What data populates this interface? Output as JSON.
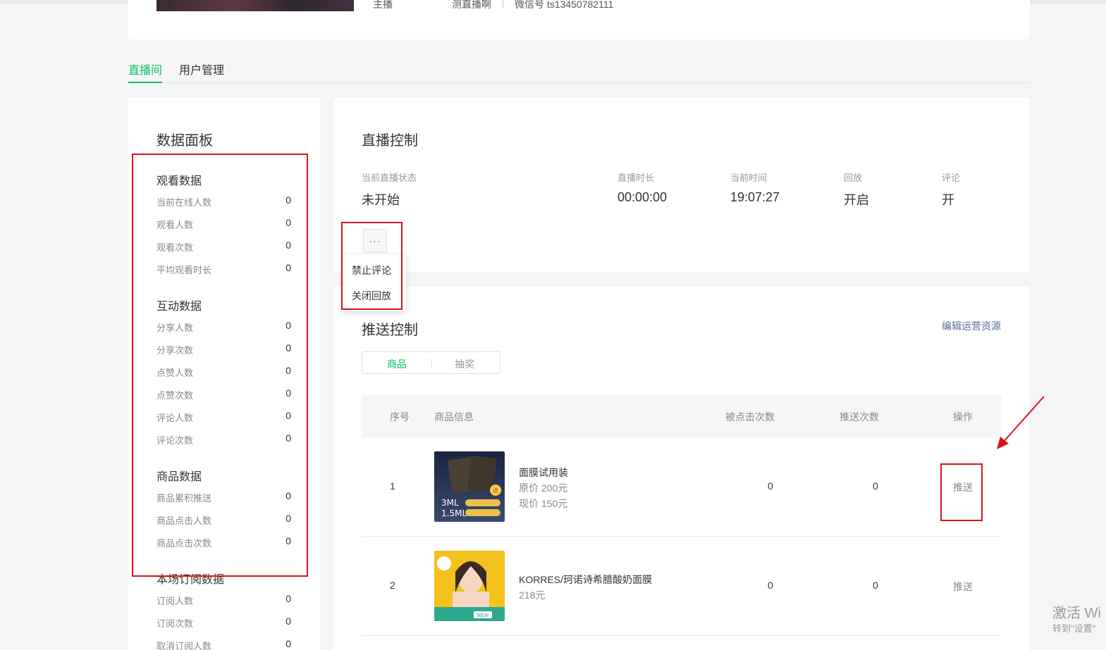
{
  "top_info": {
    "role_label": "主播",
    "name": "测直播啊",
    "wechat": "微信号 ts13450782111"
  },
  "tabs": [
    {
      "label": "直播间",
      "active": true
    },
    {
      "label": "用户管理",
      "active": false
    }
  ],
  "data_panel": {
    "title": "数据面板",
    "groups": [
      {
        "title": "观看数据",
        "stats": [
          {
            "label": "当前在线人数",
            "value": "0"
          },
          {
            "label": "观看人数",
            "value": "0"
          },
          {
            "label": "观看次数",
            "value": "0"
          },
          {
            "label": "平均观看时长",
            "value": "0"
          }
        ]
      },
      {
        "title": "互动数据",
        "stats": [
          {
            "label": "分享人数",
            "value": "0"
          },
          {
            "label": "分享次数",
            "value": "0"
          },
          {
            "label": "点赞人数",
            "value": "0"
          },
          {
            "label": "点赞次数",
            "value": "0"
          },
          {
            "label": "评论人数",
            "value": "0"
          },
          {
            "label": "评论次数",
            "value": "0"
          }
        ]
      },
      {
        "title": "商品数据",
        "stats": [
          {
            "label": "商品累积推送",
            "value": "0"
          },
          {
            "label": "商品点击人数",
            "value": "0"
          },
          {
            "label": "商品点击次数",
            "value": "0"
          }
        ]
      },
      {
        "title": "本场订阅数据",
        "stats": [
          {
            "label": "订阅人数",
            "value": "0"
          },
          {
            "label": "订阅次数",
            "value": "0"
          },
          {
            "label": "取消订阅人数",
            "value": "0"
          }
        ]
      }
    ]
  },
  "live_control": {
    "title": "直播控制",
    "fields": [
      {
        "label": "当前直播状态",
        "value": "未开始"
      },
      {
        "label": "直播时长",
        "value": "00:00:00"
      },
      {
        "label": "当前时间",
        "value": "19:07:27"
      },
      {
        "label": "回放",
        "value": "开启"
      },
      {
        "label": "评论",
        "value": "开"
      }
    ],
    "more_button": "···",
    "menu": [
      "禁止评论",
      "关闭回放"
    ]
  },
  "push_control": {
    "title": "推送控制",
    "edit_link": "编辑运营资源",
    "segments": [
      {
        "label": "商品",
        "active": true
      },
      {
        "label": "抽奖",
        "active": false
      }
    ],
    "columns": [
      "序号",
      "商品信息",
      "被点击次数",
      "推送次数",
      "操作"
    ],
    "rows": [
      {
        "index": "1",
        "name": "面膜试用装",
        "lines": [
          "原价 200元",
          "现价 150元"
        ],
        "clicks": "0",
        "pushes": "0",
        "action": "推送",
        "image_text": [
          "3ML",
          "1.5ML"
        ]
      },
      {
        "index": "2",
        "name": "KORRES/珂诺诗希腊酸奶面膜",
        "lines": [
          "218元"
        ],
        "clicks": "0",
        "pushes": "0",
        "action": "推送",
        "image_text": [
          "NEW"
        ]
      }
    ]
  },
  "watermark": {
    "line1": "激活 Wi",
    "line2": "转到\"设置\""
  },
  "colors": {
    "accent": "#07c160",
    "link": "#576b95",
    "annotation": "#d9141a"
  }
}
